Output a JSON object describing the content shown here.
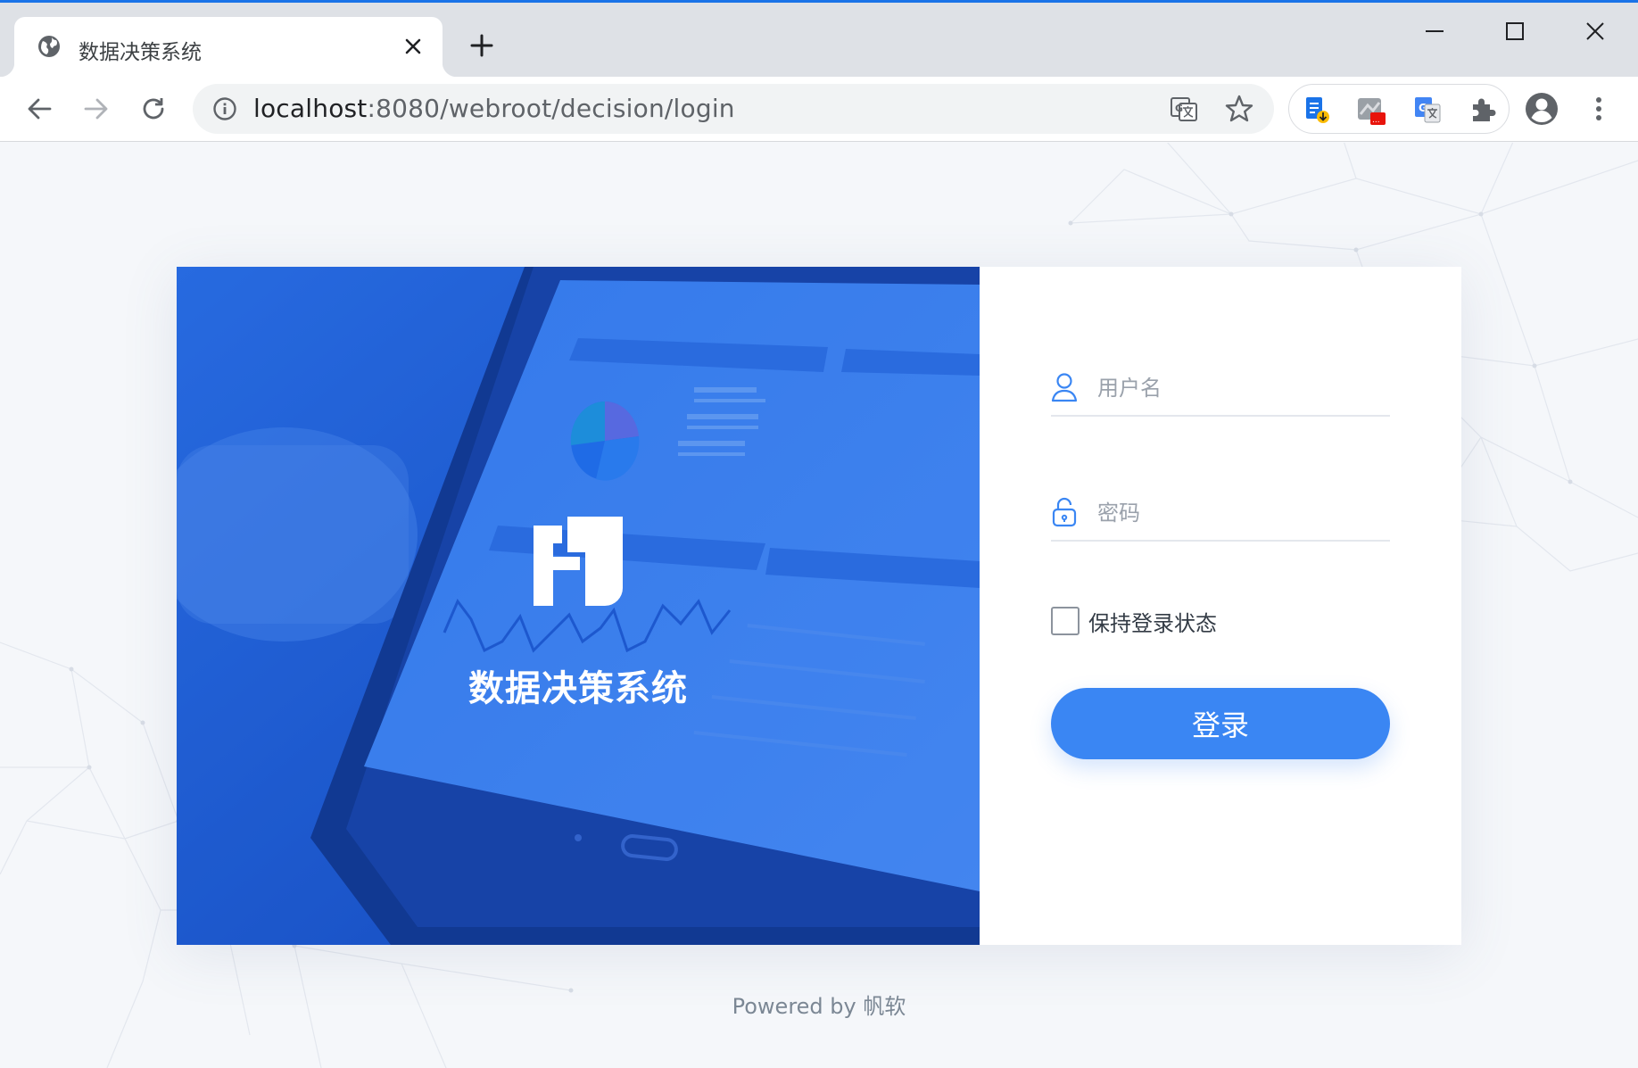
{
  "browser": {
    "tab": {
      "title": "数据决策系统",
      "close_icon": "close-icon",
      "favicon": "globe-icon"
    },
    "new_tab_icon": "plus-icon",
    "window_controls": {
      "minimize": "minimize-icon",
      "maximize": "maximize-icon",
      "close": "close-icon"
    },
    "toolbar": {
      "back_icon": "arrow-left-icon",
      "forward_icon": "arrow-right-icon",
      "reload_icon": "reload-icon",
      "url_host": "localhost",
      "url_path": ":8080/webroot/decision/login",
      "info_icon": "info-icon",
      "translate_icon": "translate-icon",
      "star_icon": "star-icon",
      "extensions": [
        "extension-doc-download-icon",
        "extension-gray-icon",
        "google-translate-icon",
        "puzzle-icon"
      ],
      "extension_badge": "...",
      "profile_icon": "profile-icon",
      "menu_icon": "more-vert-icon"
    },
    "accent_color": "#1a73e8"
  },
  "login": {
    "hero_title": "数据决策系统",
    "logo": "fanruan-logo",
    "username_placeholder": "用户名",
    "password_placeholder": "密码",
    "remember_label": "保持登录状态",
    "remember_checked": false,
    "submit_label": "登录",
    "primary_color": "#3a86f3"
  },
  "footer": {
    "powered_by": "Powered by 帆软"
  }
}
